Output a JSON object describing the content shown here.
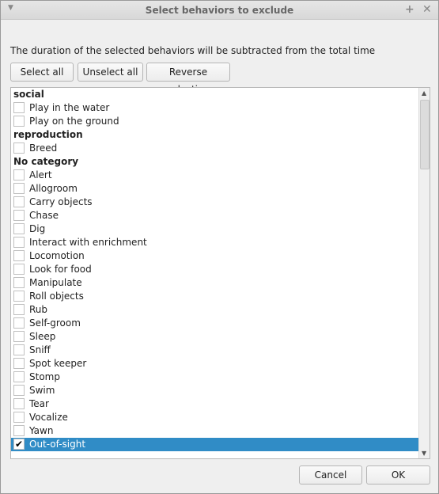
{
  "window": {
    "title": "Select behaviors to exclude"
  },
  "info": "The duration of the selected behaviors will be subtracted from the total time",
  "buttons": {
    "select_all": "Select all",
    "unselect_all": "Unselect all",
    "reverse": "Reverse selection",
    "cancel": "Cancel",
    "ok": "OK"
  },
  "rows": [
    {
      "type": "category",
      "label": "social"
    },
    {
      "type": "item",
      "label": "Play in the water",
      "checked": false
    },
    {
      "type": "item",
      "label": "Play on the ground",
      "checked": false
    },
    {
      "type": "category",
      "label": "reproduction"
    },
    {
      "type": "item",
      "label": "Breed",
      "checked": false
    },
    {
      "type": "category",
      "label": "No category"
    },
    {
      "type": "item",
      "label": "Alert",
      "checked": false
    },
    {
      "type": "item",
      "label": "Allogroom",
      "checked": false
    },
    {
      "type": "item",
      "label": "Carry objects",
      "checked": false
    },
    {
      "type": "item",
      "label": "Chase",
      "checked": false
    },
    {
      "type": "item",
      "label": "Dig",
      "checked": false
    },
    {
      "type": "item",
      "label": "Interact with enrichment",
      "checked": false
    },
    {
      "type": "item",
      "label": "Locomotion",
      "checked": false
    },
    {
      "type": "item",
      "label": "Look for food",
      "checked": false
    },
    {
      "type": "item",
      "label": "Manipulate",
      "checked": false
    },
    {
      "type": "item",
      "label": "Roll objects",
      "checked": false
    },
    {
      "type": "item",
      "label": "Rub",
      "checked": false
    },
    {
      "type": "item",
      "label": "Self-groom",
      "checked": false
    },
    {
      "type": "item",
      "label": "Sleep",
      "checked": false
    },
    {
      "type": "item",
      "label": "Sniff",
      "checked": false
    },
    {
      "type": "item",
      "label": "Spot keeper",
      "checked": false
    },
    {
      "type": "item",
      "label": "Stomp",
      "checked": false
    },
    {
      "type": "item",
      "label": "Swim",
      "checked": false
    },
    {
      "type": "item",
      "label": "Tear",
      "checked": false
    },
    {
      "type": "item",
      "label": "Vocalize",
      "checked": false
    },
    {
      "type": "item",
      "label": "Yawn",
      "checked": false
    },
    {
      "type": "item",
      "label": "Out-of-sight",
      "checked": true,
      "selected": true
    }
  ],
  "colors": {
    "selection": "#308cc6"
  }
}
